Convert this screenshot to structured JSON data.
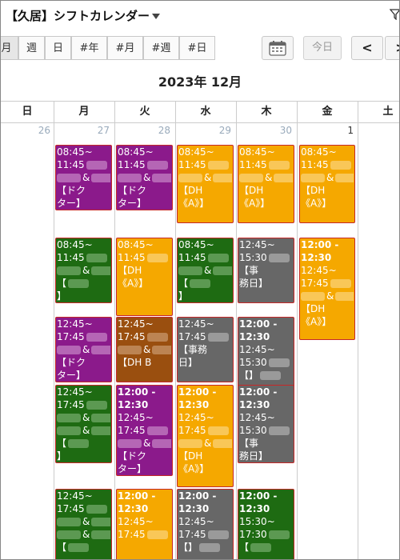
{
  "header": {
    "title": "【久居】シフトカレンダー"
  },
  "toolbar": {
    "views": [
      "月",
      "週",
      "日",
      "#年",
      "#月",
      "#週",
      "#日"
    ],
    "today_label": "今日",
    "prev_label": "<",
    "next_label": ">"
  },
  "calendar": {
    "month_label": "2023年 12月",
    "weekdays": [
      "日",
      "月",
      "火",
      "水",
      "木",
      "金",
      "土"
    ],
    "dates": [
      "26",
      "27",
      "28",
      "29",
      "30",
      "1"
    ]
  },
  "events": [
    {
      "col": 1,
      "color": "purple",
      "lines": [
        "08:45~",
        "11:45",
        "&",
        "【ドク",
        "ター】"
      ]
    },
    {
      "col": 2,
      "color": "purple",
      "lines": [
        "08:45~",
        "11:45",
        "&",
        "【ドク",
        "ター】"
      ]
    },
    {
      "col": 3,
      "color": "orange",
      "lines": [
        "08:45~",
        "11:45",
        "&",
        "【DH",
        "《A》】"
      ]
    },
    {
      "col": 4,
      "color": "orange",
      "lines": [
        "08:45~",
        "11:45",
        "&",
        "【DH",
        "《A》】"
      ]
    },
    {
      "col": 5,
      "color": "orange",
      "lines": [
        "08:45~",
        "11:45",
        "&",
        "【DH",
        "《A》】"
      ]
    },
    {
      "col": 1,
      "color": "green",
      "lines": [
        "08:45~",
        "11:45",
        "&",
        "【",
        "】"
      ]
    },
    {
      "col": 2,
      "color": "orange",
      "lines": [
        "08:45~",
        "11:45",
        "【DH",
        "《A》】"
      ]
    },
    {
      "col": 3,
      "color": "green",
      "lines": [
        "08:45~",
        "11:45",
        "&",
        "【",
        "】"
      ]
    },
    {
      "col": 4,
      "color": "gray",
      "lines": [
        "12:45~",
        "15:30",
        "【事",
        "務日】"
      ]
    },
    {
      "col": 5,
      "color": "orange",
      "lines": [
        "12:00 -",
        "12:30",
        "12:45~",
        "17:45",
        "&",
        "【DH",
        "《A》】"
      ]
    },
    {
      "col": 1,
      "color": "purple",
      "lines": [
        "12:45~",
        "17:45",
        "&",
        "【ドク",
        "ター】"
      ]
    },
    {
      "col": 2,
      "color": "brown",
      "lines": [
        "12:45~",
        "17:45",
        "&",
        "【DH B"
      ]
    },
    {
      "col": 3,
      "color": "gray",
      "lines": [
        "12:45~",
        "17:45",
        "【事務",
        "日】"
      ]
    },
    {
      "col": 4,
      "color": "gray",
      "lines": [
        "12:00 -",
        "12:30",
        "12:45~",
        "15:30",
        "【】"
      ]
    },
    {
      "col": 1,
      "color": "green",
      "lines": [
        "12:45~",
        "17:45",
        "&",
        "&",
        "【",
        "】"
      ]
    },
    {
      "col": 2,
      "color": "purple",
      "lines": [
        "12:00 -",
        "12:30",
        "12:45~",
        "17:45",
        "&",
        "【ドク",
        "ター】"
      ]
    },
    {
      "col": 3,
      "color": "orange",
      "lines": [
        "12:00 -",
        "12:30",
        "12:45~",
        "17:45",
        "&",
        "【DH",
        "《A》】"
      ]
    },
    {
      "col": 4,
      "color": "gray",
      "lines": [
        "12:00 -",
        "12:30",
        "12:45~",
        "15:30",
        "【事",
        "務日】"
      ]
    },
    {
      "col": 1,
      "color": "green",
      "lines": [
        "12:45~",
        "17:45",
        "&",
        "&",
        "【"
      ]
    },
    {
      "col": 2,
      "color": "orange",
      "lines": [
        "12:00 -",
        "12:30",
        "12:45~",
        "17:45"
      ]
    },
    {
      "col": 3,
      "color": "gray",
      "lines": [
        "12:00 -",
        "12:30",
        "12:45~",
        "17:45",
        "【】"
      ]
    },
    {
      "col": 4,
      "color": "green",
      "lines": [
        "12:00 -",
        "12:30",
        "15:30~",
        "17:30",
        "【"
      ]
    }
  ]
}
